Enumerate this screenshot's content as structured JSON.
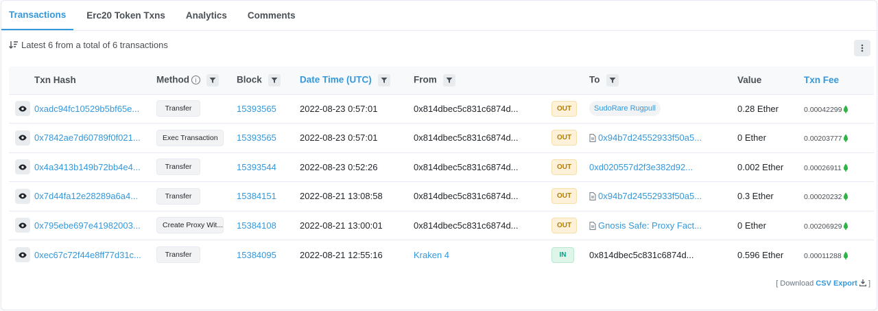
{
  "tabs": [
    {
      "label": "Transactions",
      "active": true
    },
    {
      "label": "Erc20 Token Txns",
      "active": false
    },
    {
      "label": "Analytics",
      "active": false
    },
    {
      "label": "Comments",
      "active": false
    }
  ],
  "summary": "Latest 6 from a total of 6 transactions",
  "columns": {
    "txn_hash": "Txn Hash",
    "method": "Method",
    "block": "Block",
    "datetime": "Date Time (UTC)",
    "from": "From",
    "to": "To",
    "value": "Value",
    "fee": "Txn Fee"
  },
  "rows": [
    {
      "hash": "0xadc94fc10529b5bf65e...",
      "method": "Transfer",
      "block": "15393565",
      "datetime": "2022-08-23 0:57:01",
      "from": "0x814dbec5c831c6874d...",
      "dir": "OUT",
      "to": "SudoRare Rugpull",
      "value": "0.28 Ether",
      "fee": "0.00042299"
    },
    {
      "hash": "0x7842ae7d60789f0f021...",
      "method": "Exec Transaction",
      "block": "15393565",
      "datetime": "2022-08-23 0:57:01",
      "from": "0x814dbec5c831c6874d...",
      "dir": "OUT",
      "to": "0x94b7d24552933f50a5...",
      "value": "0 Ether",
      "fee": "0.00203777"
    },
    {
      "hash": "0x4a3413b149b72bb4e4...",
      "method": "Transfer",
      "block": "15393544",
      "datetime": "2022-08-23 0:52:26",
      "from": "0x814dbec5c831c6874d...",
      "dir": "OUT",
      "to": "0xd020557d2f3e382d92...",
      "value": "0.002 Ether",
      "fee": "0.00026911"
    },
    {
      "hash": "0x7d44fa12e28289a6a4...",
      "method": "Transfer",
      "block": "15384151",
      "datetime": "2022-08-21 13:08:58",
      "from": "0x814dbec5c831c6874d...",
      "dir": "OUT",
      "to": "0x94b7d24552933f50a5...",
      "value": "0.3 Ether",
      "fee": "0.00020232"
    },
    {
      "hash": "0x795ebe697e41982003...",
      "method": "Create Proxy Wit...",
      "block": "15384108",
      "datetime": "2022-08-21 13:00:01",
      "from": "0x814dbec5c831c6874d...",
      "dir": "OUT",
      "to": "Gnosis Safe: Proxy Fact...",
      "value": "0 Ether",
      "fee": "0.00206929"
    },
    {
      "hash": "0xec67c72f44e8ff77d31c...",
      "method": "Transfer",
      "block": "15384095",
      "datetime": "2022-08-21 12:55:16",
      "from": "Kraken 4",
      "dir": "IN",
      "to": "0x814dbec5c831c6874d...",
      "value": "0.596 Ether",
      "fee": "0.00011288"
    }
  ],
  "footer": {
    "prefix": "[ Download",
    "link": "CSV Export",
    "suffix": "]"
  },
  "colors": {
    "accent": "#3498db",
    "out": "#b47d00",
    "in": "#00a186"
  }
}
